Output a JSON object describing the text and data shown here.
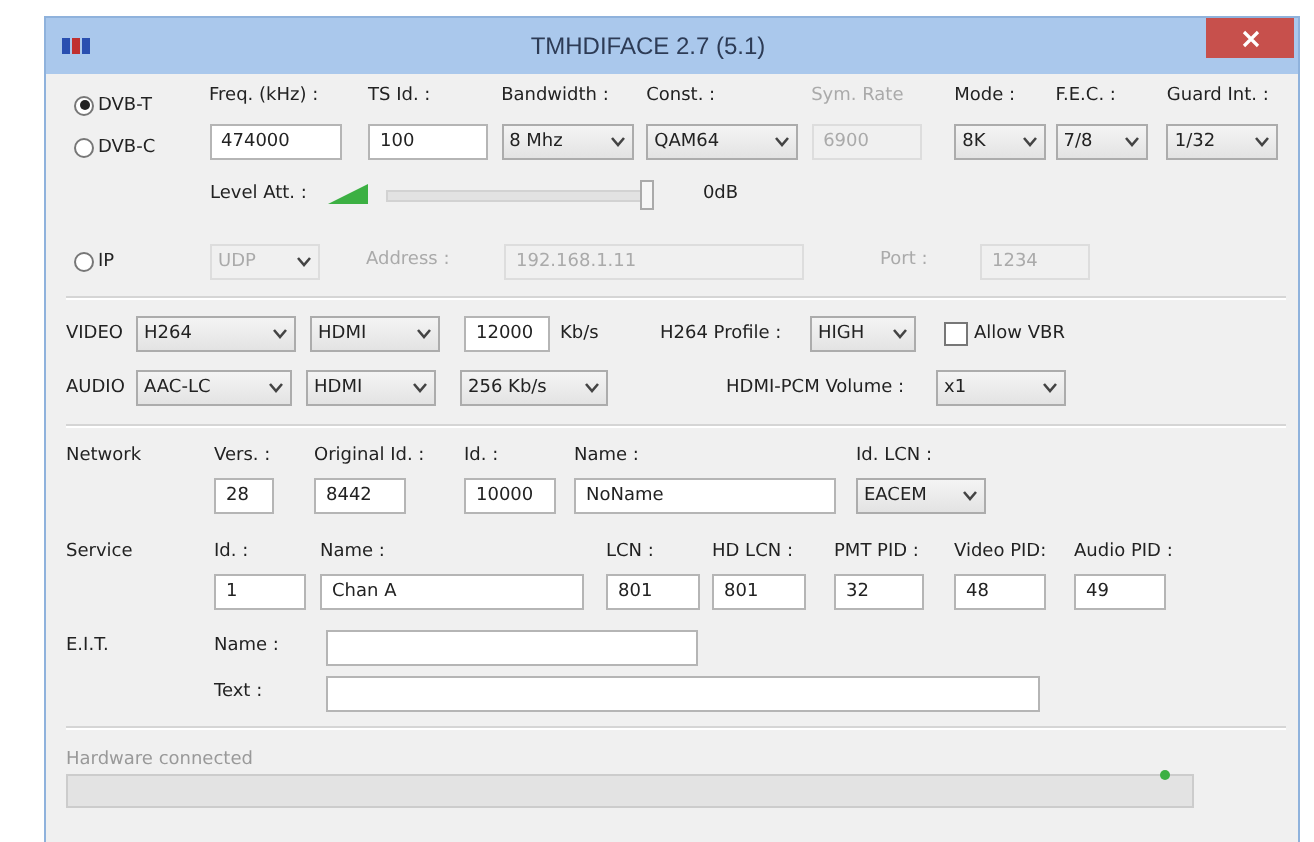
{
  "window": {
    "title": "TMHDIFACE 2.7 (5.1)"
  },
  "sources": [
    {
      "label": "DVB-T",
      "selected": true
    },
    {
      "label": "DVB-C",
      "selected": false
    },
    {
      "label": "IP",
      "selected": false
    }
  ],
  "tuning": [
    {
      "label": "Freq. (kHz) :",
      "value": "474000",
      "kind": "text",
      "disabled": false
    },
    {
      "label": "TS Id. :",
      "value": "100",
      "kind": "text",
      "disabled": false
    },
    {
      "label": "Bandwidth :",
      "value": "8 Mhz",
      "kind": "select",
      "disabled": false
    },
    {
      "label": "Const. :",
      "value": "QAM64",
      "kind": "select",
      "disabled": false
    },
    {
      "label": "Sym. Rate",
      "value": "6900",
      "kind": "text",
      "disabled": true
    },
    {
      "label": "Mode :",
      "value": "8K",
      "kind": "select",
      "disabled": false
    },
    {
      "label": "F.E.C. :",
      "value": "7/8",
      "kind": "select",
      "disabled": false
    },
    {
      "label": "Guard Int. :",
      "value": "1/32",
      "kind": "select",
      "disabled": false
    }
  ],
  "level_att": {
    "label": "Level Att. :",
    "level": 1,
    "reading": "0dB"
  },
  "ip": {
    "disabled": true,
    "protocol": "UDP",
    "address_label": "Address :",
    "address": "192.168.1.11",
    "port_label": "Port :",
    "port": "1234"
  },
  "video": {
    "label": "VIDEO",
    "codec": "H264",
    "output": "HDMI",
    "bitrate": "12000",
    "unit": "Kb/s",
    "profile_label": "H264 Profile :",
    "profile": "HIGH",
    "allow_vbr": {
      "label": "Allow VBR",
      "checked": false
    }
  },
  "audio": {
    "label": "AUDIO",
    "codec": "AAC-LC",
    "output": "HDMI",
    "bitrate": "256 Kb/s",
    "volume_label": "HDMI-PCM Volume :",
    "volume": "x1"
  },
  "network": {
    "label": "Network",
    "fields": [
      {
        "label": "Vers. :",
        "value": "28",
        "kind": "text"
      },
      {
        "label": "Original Id. :",
        "value": "8442",
        "kind": "text"
      },
      {
        "label": "Id. :",
        "value": "10000",
        "kind": "text"
      },
      {
        "label": "Name :",
        "value": "NoName",
        "kind": "text"
      },
      {
        "label": "Id. LCN :",
        "value": "EACEM",
        "kind": "select"
      }
    ]
  },
  "service": {
    "label": "Service",
    "fields": [
      {
        "label": "Id. :",
        "value": "1",
        "kind": "text"
      },
      {
        "label": "Name :",
        "value": "Chan A",
        "kind": "text"
      },
      {
        "label": "LCN :",
        "value": "801",
        "kind": "text"
      },
      {
        "label": "HD LCN :",
        "value": "801",
        "kind": "text"
      },
      {
        "label": "PMT PID :",
        "value": "32",
        "kind": "text"
      },
      {
        "label": "Video PID:",
        "value": "48",
        "kind": "text"
      },
      {
        "label": "Audio PID :",
        "value": "49",
        "kind": "text"
      }
    ]
  },
  "eit": {
    "label": "E.I.T.",
    "fields": [
      {
        "label": "Name :"
      },
      {
        "label": "Text :"
      }
    ]
  },
  "status_bar": {
    "text": "Hardware connected",
    "connected": true,
    "level": 0
  }
}
